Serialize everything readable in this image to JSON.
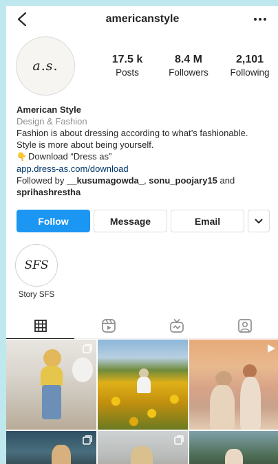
{
  "header": {
    "username": "americanstyle"
  },
  "profile": {
    "avatar_text": "a.s.",
    "stats": [
      {
        "value": "17.5 k",
        "label": "Posts"
      },
      {
        "value": "8.4 M",
        "label": "Followers"
      },
      {
        "value": "2,101",
        "label": "Following"
      }
    ],
    "name": "American Style",
    "category": "Design & Fashion",
    "bio_line1": "Fashion is about dressing according to what’s fashionable.",
    "bio_line2": "Style is more about being yourself.",
    "bio_download": "Download “Dress as”",
    "link": "app.dress-as.com/download",
    "followed_by_prefix": "Followed by ",
    "followed_by_user1": "__kusumagowda_",
    "followed_by_sep": ", ",
    "followed_by_user2": "sonu_poojary15",
    "followed_by_and": " and",
    "followed_by_user3": "sprihashrestha"
  },
  "actions": {
    "follow_label": "Follow",
    "message_label": "Message",
    "email_label": "Email"
  },
  "highlights": [
    {
      "cover_text": "SFS",
      "label": "Story SFS"
    }
  ],
  "tabs": [
    {
      "icon": "grid-icon",
      "active": true
    },
    {
      "icon": "reels-icon",
      "active": false
    },
    {
      "icon": "igtv-icon",
      "active": false
    },
    {
      "icon": "tagged-icon",
      "active": false
    }
  ],
  "colors": {
    "follow": "#1c96f3",
    "link": "#00376b",
    "muted": "#8e8e8e"
  }
}
